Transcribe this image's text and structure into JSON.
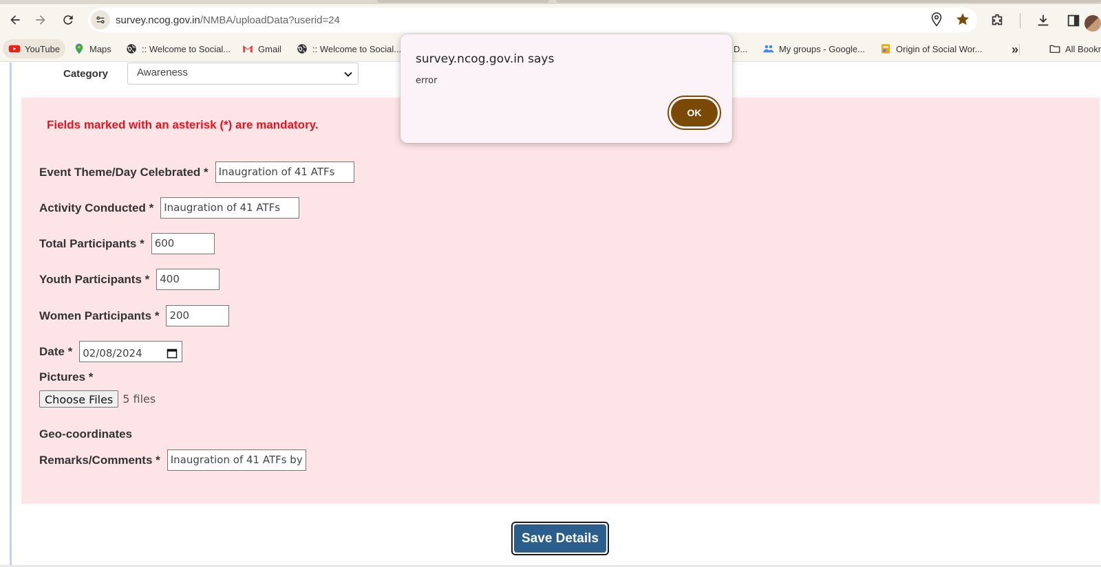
{
  "browser": {
    "url_host": "survey.ncog.gov.in",
    "url_path": "/NMBA/uploadData?userid=24"
  },
  "bookmarks": [
    {
      "label": "YouTube",
      "icon": "youtube-icon"
    },
    {
      "label": "Maps",
      "icon": "maps-pin-icon"
    },
    {
      "label": ":: Welcome to Social...",
      "icon": "globe-icon"
    },
    {
      "label": "Gmail",
      "icon": "gmail-icon"
    },
    {
      "label": ":: Welcome to Social...",
      "icon": "globe-icon"
    },
    {
      "label": "D...",
      "icon": ""
    },
    {
      "label": "My groups - Google...",
      "icon": "groups-icon"
    },
    {
      "label": "Origin of Social Wor...",
      "icon": "site-favicon"
    },
    {
      "label": "All Bookmarks",
      "icon": "folder-icon"
    }
  ],
  "form": {
    "category_label": "Category",
    "category_value": "Awareness",
    "mandatory_note": "Fields marked with an asterisk (*) are mandatory.",
    "fields": {
      "event_theme": {
        "label": "Event Theme/Day Celebrated *",
        "value": "Inaugration of 41 ATFs"
      },
      "activity": {
        "label": "Activity Conducted *",
        "value": "Inaugration of 41 ATFs"
      },
      "total": {
        "label": "Total Participants *",
        "value": "600"
      },
      "youth": {
        "label": "Youth Participants *",
        "value": "400"
      },
      "women": {
        "label": "Women Participants *",
        "value": "200"
      },
      "date": {
        "label": "Date *",
        "value": "02/08/2024"
      },
      "pictures": {
        "label": "Pictures *",
        "button": "Choose Files",
        "note": "5 files"
      },
      "geo": {
        "label": "Geo-coordinates"
      },
      "remarks": {
        "label": "Remarks/Comments *",
        "value": "Inaugration of 41 ATFs by"
      }
    },
    "save_label": "Save Details"
  },
  "dialog": {
    "title": "survey.ncog.gov.in says",
    "message": "error",
    "ok_label": "OK"
  },
  "colors": {
    "panel_bg": "#fde4e6",
    "mandatory_red": "#e8131c",
    "save_blue": "#2b5e8c",
    "ok_brown": "#7a4a05"
  }
}
